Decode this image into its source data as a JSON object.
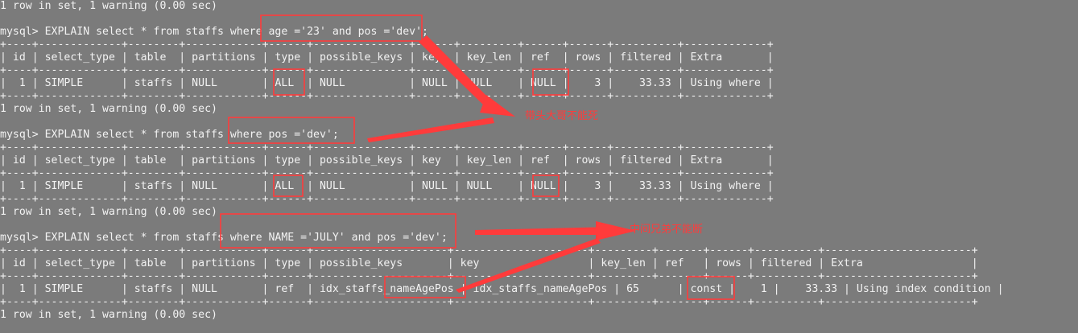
{
  "terminal": {
    "lines": [
      "1 row in set, 1 warning (0.00 sec)",
      "",
      "mysql> EXPLAIN select * from staffs where age ='23' and pos ='dev';",
      "+----+-------------+--------+------------+------+---------------+------+---------+------+------+----------+-------------+",
      "| id | select_type | table  | partitions | type | possible_keys | key  | key_len | ref  | rows | filtered | Extra       |",
      "+----+-------------+--------+------------+------+---------------+------+---------+------+------+----------+-------------+",
      "|  1 | SIMPLE      | staffs | NULL       | ALL  | NULL          | NULL | NULL    | NULL |    3 |    33.33 | Using where |",
      "+----+-------------+--------+------------+------+---------------+------+---------+------+------+----------+-------------+",
      "1 row in set, 1 warning (0.00 sec)",
      "",
      "mysql> EXPLAIN select * from staffs where pos ='dev';",
      "+----+-------------+--------+------------+------+---------------+------+---------+------+------+----------+-------------+",
      "| id | select_type | table  | partitions | type | possible_keys | key  | key_len | ref  | rows | filtered | Extra       |",
      "+----+-------------+--------+------------+------+---------------+------+---------+------+------+----------+-------------+",
      "|  1 | SIMPLE      | staffs | NULL       | ALL  | NULL          | NULL | NULL    | NULL |    3 |    33.33 | Using where |",
      "+----+-------------+--------+------------+------+---------------+------+---------+------+------+----------+-------------+",
      "1 row in set, 1 warning (0.00 sec)",
      "",
      "mysql> EXPLAIN select * from staffs where NAME ='JULY' and pos ='dev';",
      "+----+-------------+--------+------------+------+---------------------+---------------------+---------+-------+------+----------+-----------------------+",
      "| id | select_type | table  | partitions | type | possible_keys       | key                 | key_len | ref   | rows | filtered | Extra                 |",
      "+----+-------------+--------+------------+------+---------------------+---------------------+---------+-------+------+----------+-----------------------+",
      "|  1 | SIMPLE      | staffs | NULL       | ref  | idx_staffs_nameAgePos | idx_staffs_nameAgePos | 65      | const |    1 |    33.33 | Using index condition |",
      "+----+-------------+--------+------------+------+---------------------+---------------------+---------+-------+------+----------+-----------------------+",
      "1 row in set, 1 warning (0.00 sec)"
    ]
  },
  "annotations": {
    "note1": "带头大哥不能死",
    "note2": "中间兄弟不能断",
    "color": "#ff3b3b"
  }
}
